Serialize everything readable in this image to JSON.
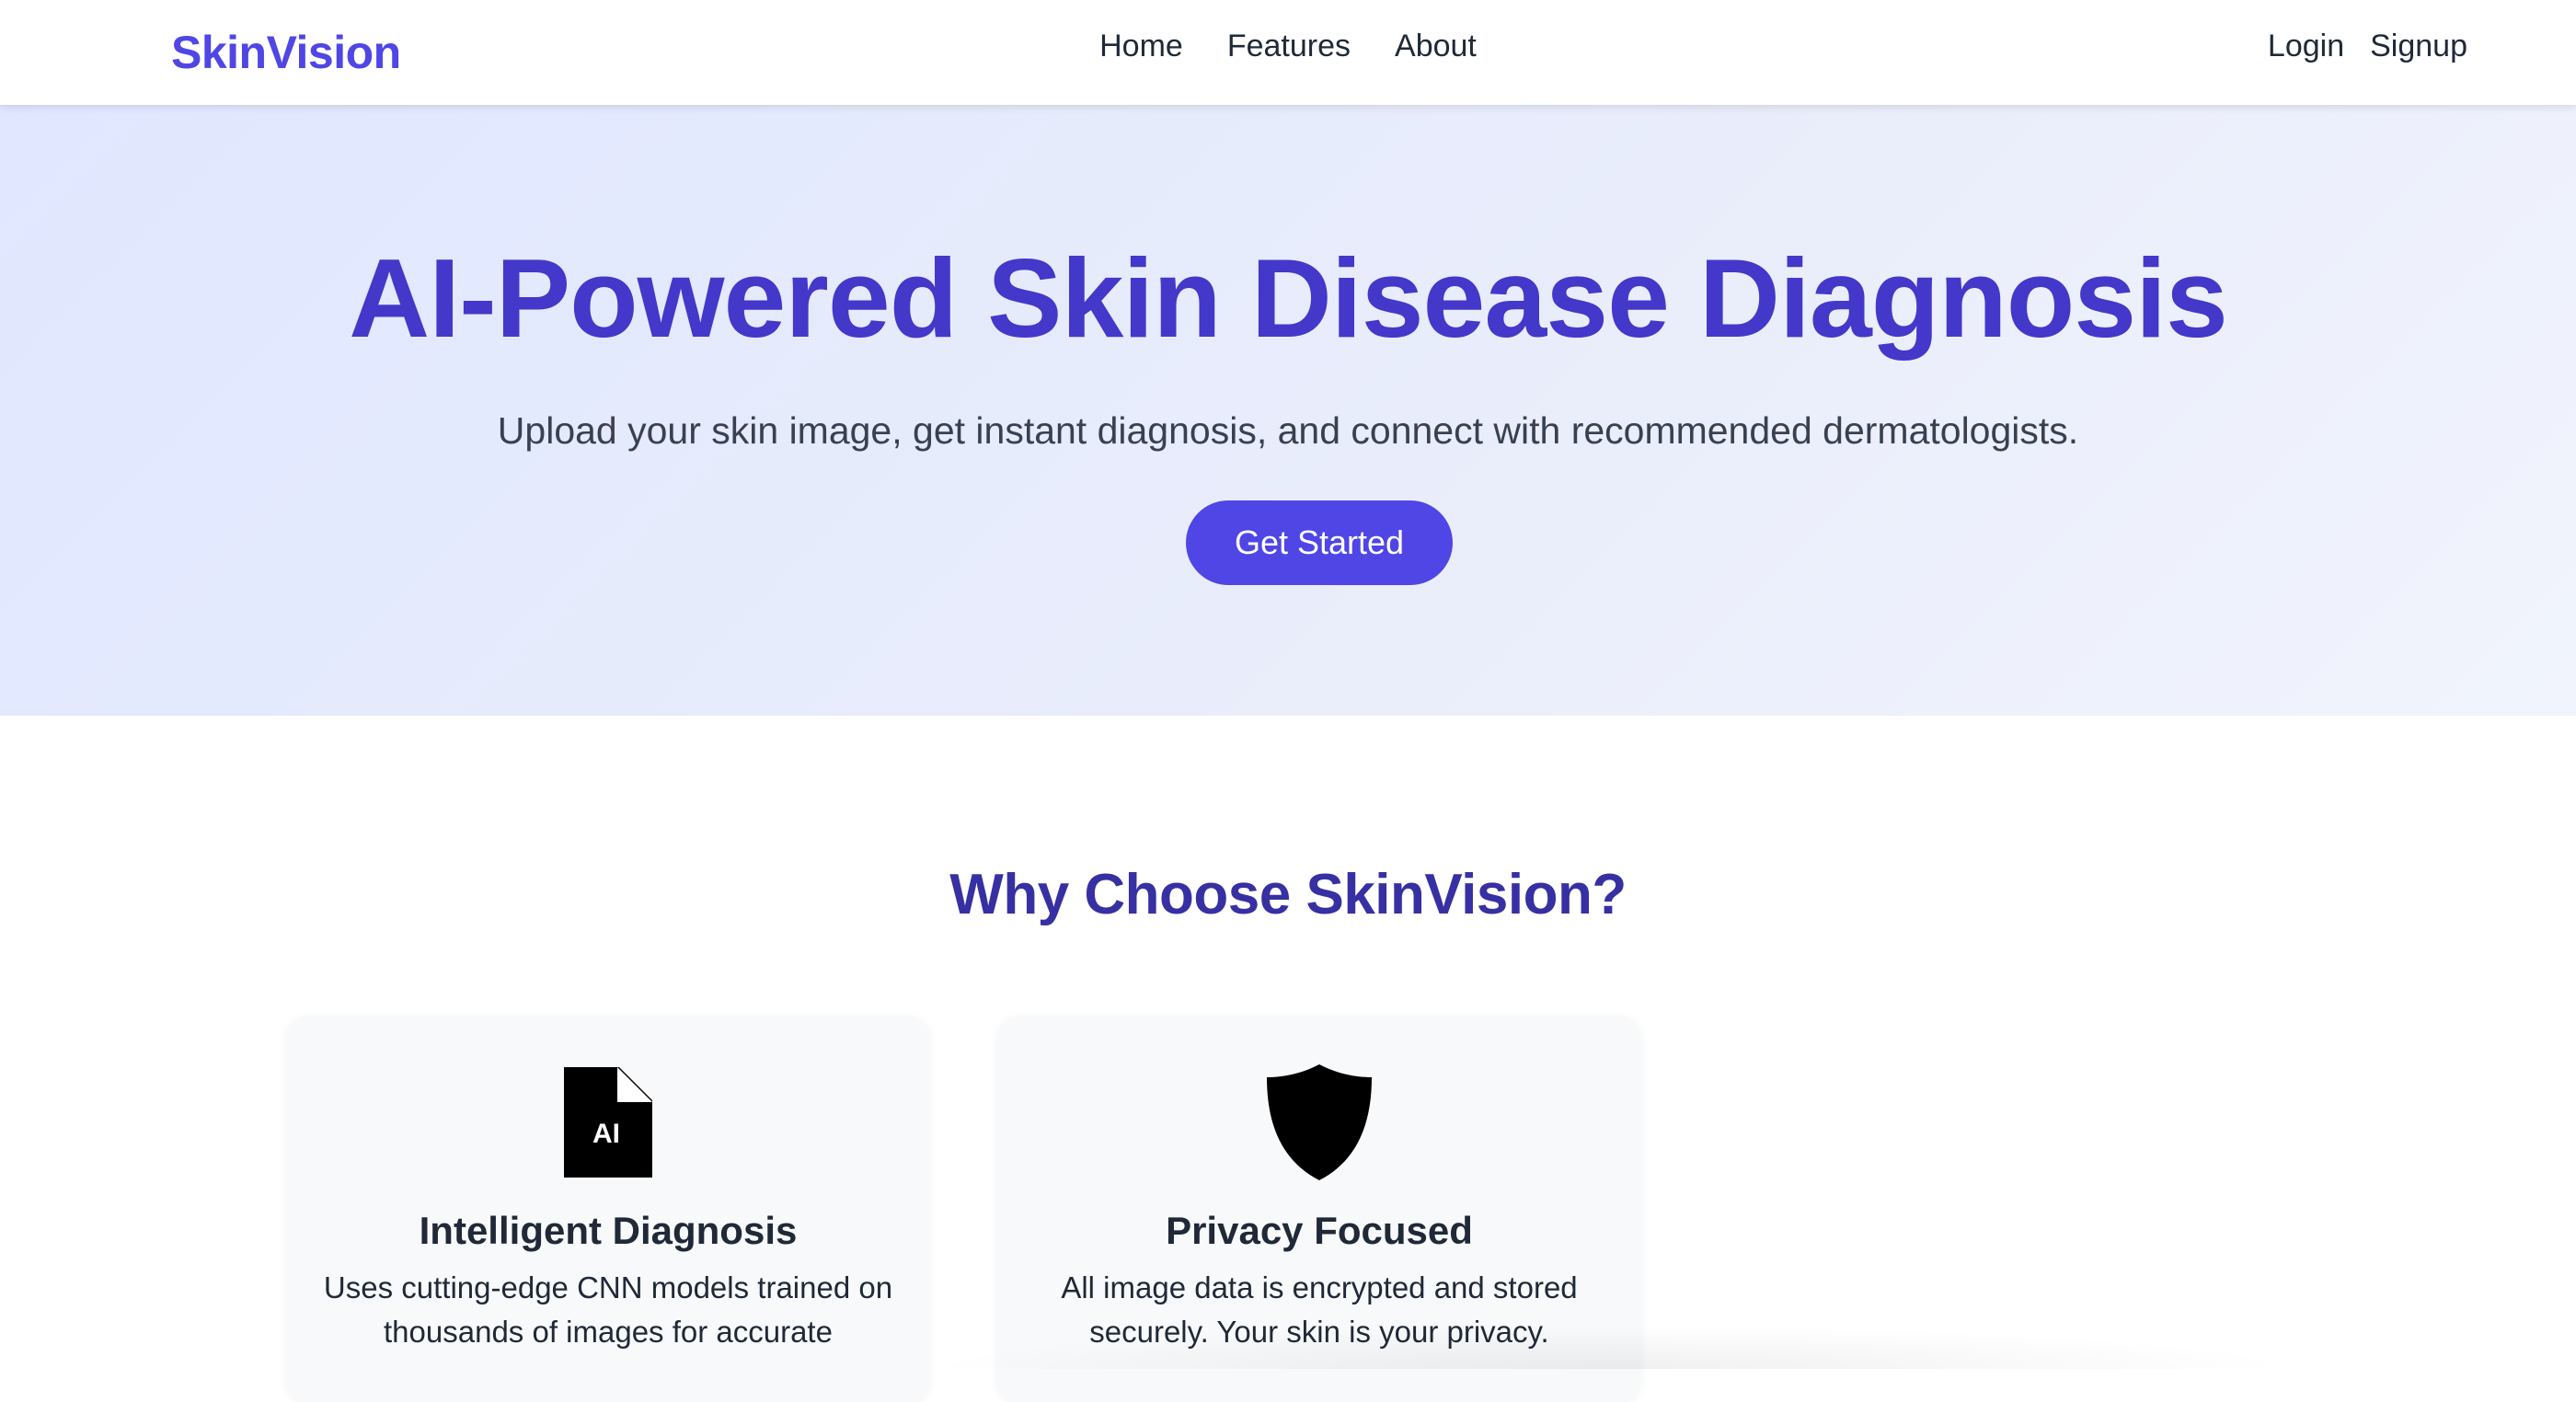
{
  "brand": {
    "name": "SkinVision",
    "color": "#4f46e5"
  },
  "nav": {
    "links": [
      {
        "label": "Home"
      },
      {
        "label": "Features"
      },
      {
        "label": "About"
      }
    ],
    "login_label": "Login",
    "signup_label": "Signup"
  },
  "hero": {
    "title": "AI-Powered Skin Disease Diagnosis",
    "subtitle": "Upload your skin image, get instant diagnosis, and connect with recommended dermatologists.",
    "cta_label": "Get Started",
    "title_color": "#4338ca",
    "cta_color": "#4f46e5"
  },
  "features": {
    "heading": "Why Choose SkinVision?",
    "cards": [
      {
        "icon": "ai-document-icon",
        "icon_text": "AI",
        "title": "Intelligent Diagnosis",
        "text": "Uses cutting-edge CNN models trained on thousands of images for accurate"
      },
      {
        "icon": "shield-icon",
        "title": "Privacy Focused",
        "text": "All image data is encrypted and stored securely. Your skin is your privacy."
      }
    ]
  }
}
